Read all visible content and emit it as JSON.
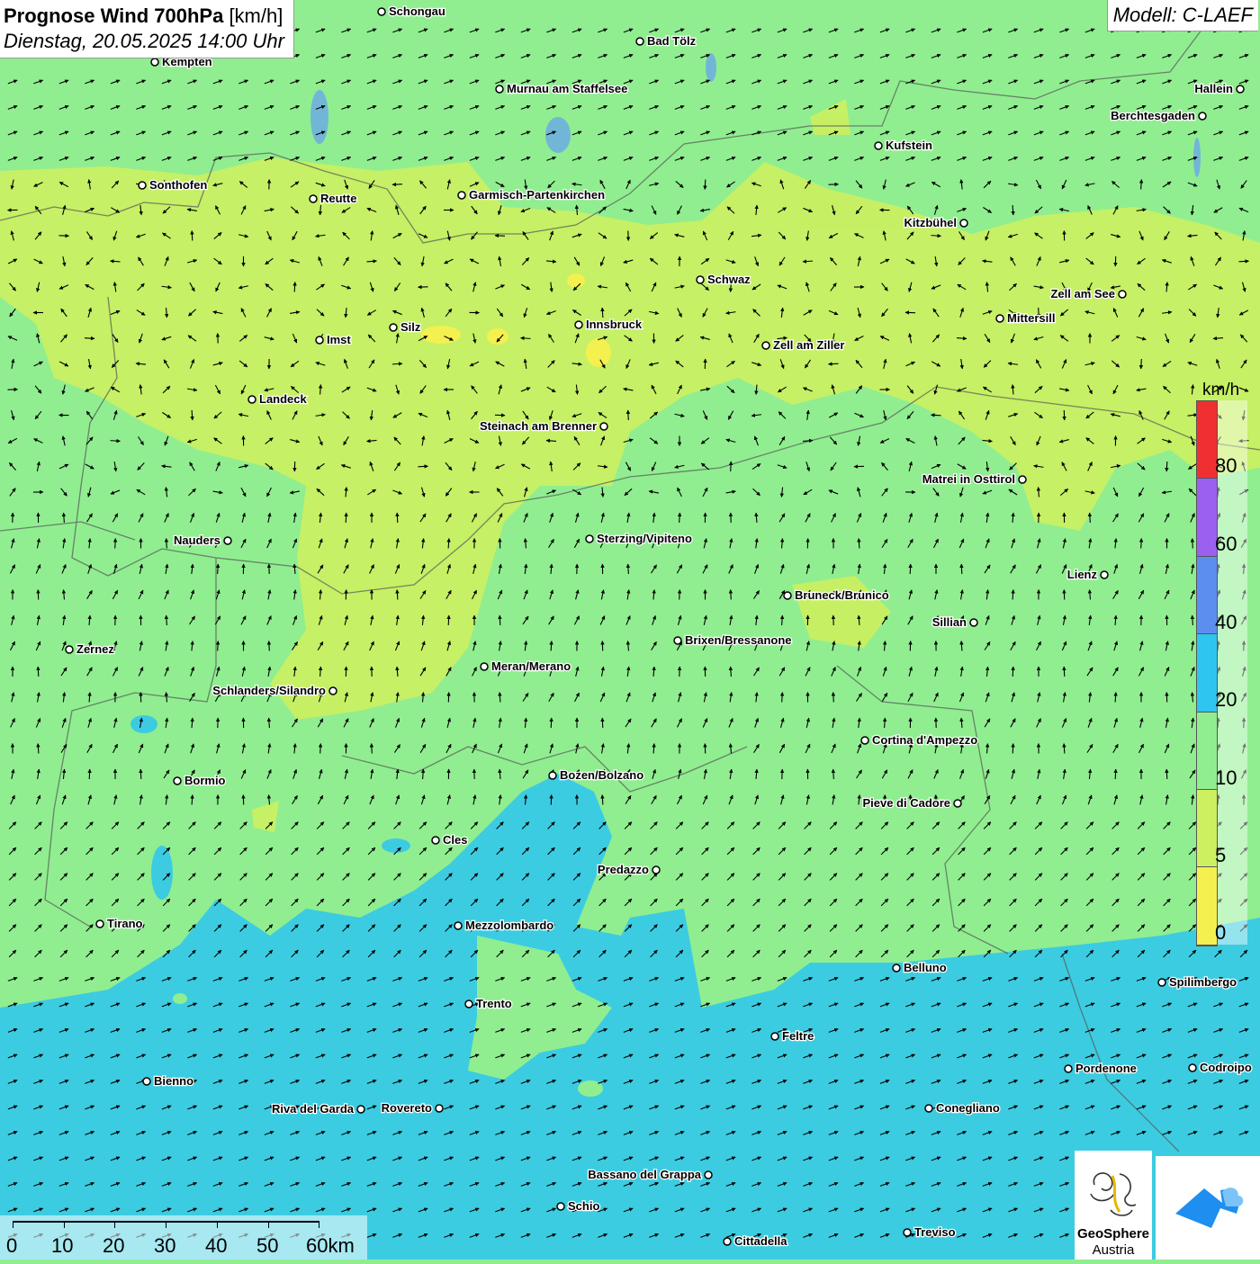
{
  "header": {
    "title_bold": "Prognose Wind 700hPa",
    "title_unit": "[km/h]",
    "subtitle": "Dienstag, 20.05.2025 14:00 Uhr"
  },
  "model": {
    "label": "Modell: C-LAEF"
  },
  "legend": {
    "unit": "km/h",
    "labels": [
      "80",
      "60",
      "40",
      "20",
      "10",
      "5",
      "0"
    ],
    "colors": [
      "#f03030",
      "#9c60f0",
      "#5c8ef0",
      "#2ec6f0",
      "#90ee90",
      "#ccf060",
      "#f4f050"
    ]
  },
  "scale_bar": {
    "labels": [
      "0",
      "10",
      "20",
      "30",
      "40",
      "50",
      "60km"
    ]
  },
  "branding": {
    "name_line1": "GeoSphere",
    "name_line2": "Austria"
  },
  "places": [
    {
      "name": "Schongau"
    },
    {
      "name": "Bad Tölz"
    },
    {
      "name": "Kempten"
    },
    {
      "name": "Murnau am Staffelsee"
    },
    {
      "name": "Hallein"
    },
    {
      "name": "Berchtesgaden"
    },
    {
      "name": "Kufstein"
    },
    {
      "name": "Sonthofen"
    },
    {
      "name": "Reutte"
    },
    {
      "name": "Garmisch-Partenkirchen"
    },
    {
      "name": "Kitzbühel"
    },
    {
      "name": "Schwaz"
    },
    {
      "name": "Zell am See"
    },
    {
      "name": "Mittersill"
    },
    {
      "name": "Innsbruck"
    },
    {
      "name": "Silz"
    },
    {
      "name": "Imst"
    },
    {
      "name": "Zell am Ziller"
    },
    {
      "name": "Landeck"
    },
    {
      "name": "Steinach am Brenner"
    },
    {
      "name": "Matrei in Osttirol"
    },
    {
      "name": "Nauders"
    },
    {
      "name": "Sterzing/Vipiteno"
    },
    {
      "name": "Lienz"
    },
    {
      "name": "Bruneck/Brunico"
    },
    {
      "name": "Sillian"
    },
    {
      "name": "Zernez"
    },
    {
      "name": "Brixen/Bressanone"
    },
    {
      "name": "Meran/Merano"
    },
    {
      "name": "Schlanders/Silandro"
    },
    {
      "name": "Cortina d'Ampezzo"
    },
    {
      "name": "Bormio"
    },
    {
      "name": "Bozen/Bolzano"
    },
    {
      "name": "Pieve di Cadore"
    },
    {
      "name": "Cles"
    },
    {
      "name": "Predazzo"
    },
    {
      "name": "Tirano"
    },
    {
      "name": "Mezzolombardo"
    },
    {
      "name": "Belluno"
    },
    {
      "name": "Spilimbergo"
    },
    {
      "name": "Trento"
    },
    {
      "name": "Feltre"
    },
    {
      "name": "Pordenone"
    },
    {
      "name": "Codroipo"
    },
    {
      "name": "Bienno"
    },
    {
      "name": "Riva del Garda"
    },
    {
      "name": "Rovereto"
    },
    {
      "name": "Conegliano"
    },
    {
      "name": "Bassano del Grappa"
    },
    {
      "name": "Schio"
    },
    {
      "name": "Treviso"
    },
    {
      "name": "Cittadella"
    }
  ]
}
